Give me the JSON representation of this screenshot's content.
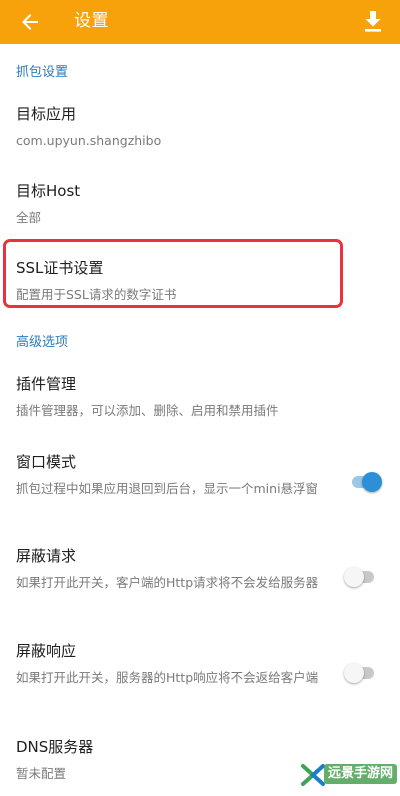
{
  "colors": {
    "appbar": "#f7a10b",
    "section_header": "#2a7bbd",
    "highlight_border": "#e8333e",
    "switch_on": "#2d8fd6"
  },
  "appbar": {
    "title": "设置",
    "back_icon": "arrow-back-icon",
    "action_icon": "download-icon"
  },
  "sections": [
    {
      "header": "抓包设置",
      "items": [
        {
          "title": "目标应用",
          "summary": "com.upyun.shangzhibo"
        },
        {
          "title": "目标Host",
          "summary": "全部"
        },
        {
          "title": "SSL证书设置",
          "summary": "配置用于SSL请求的数字证书",
          "highlighted": true
        }
      ]
    },
    {
      "header": "高级选项",
      "items": [
        {
          "title": "插件管理",
          "summary": "插件管理器，可以添加、删除、启用和禁用插件"
        },
        {
          "title": "窗口模式",
          "summary": "抓包过程中如果应用退回到后台，显示一个mini悬浮窗",
          "switch": true
        },
        {
          "title": "屏蔽请求",
          "summary": "如果打开此开关，客户端的Http请求将不会发给服务器",
          "switch": false
        },
        {
          "title": "屏蔽响应",
          "summary": "如果打开此开关，服务器的Http响应将不会返给客户端",
          "switch": false
        },
        {
          "title": "DNS服务器",
          "summary": "暂未配置"
        }
      ]
    }
  ],
  "watermark": {
    "text": "远景手游网"
  }
}
